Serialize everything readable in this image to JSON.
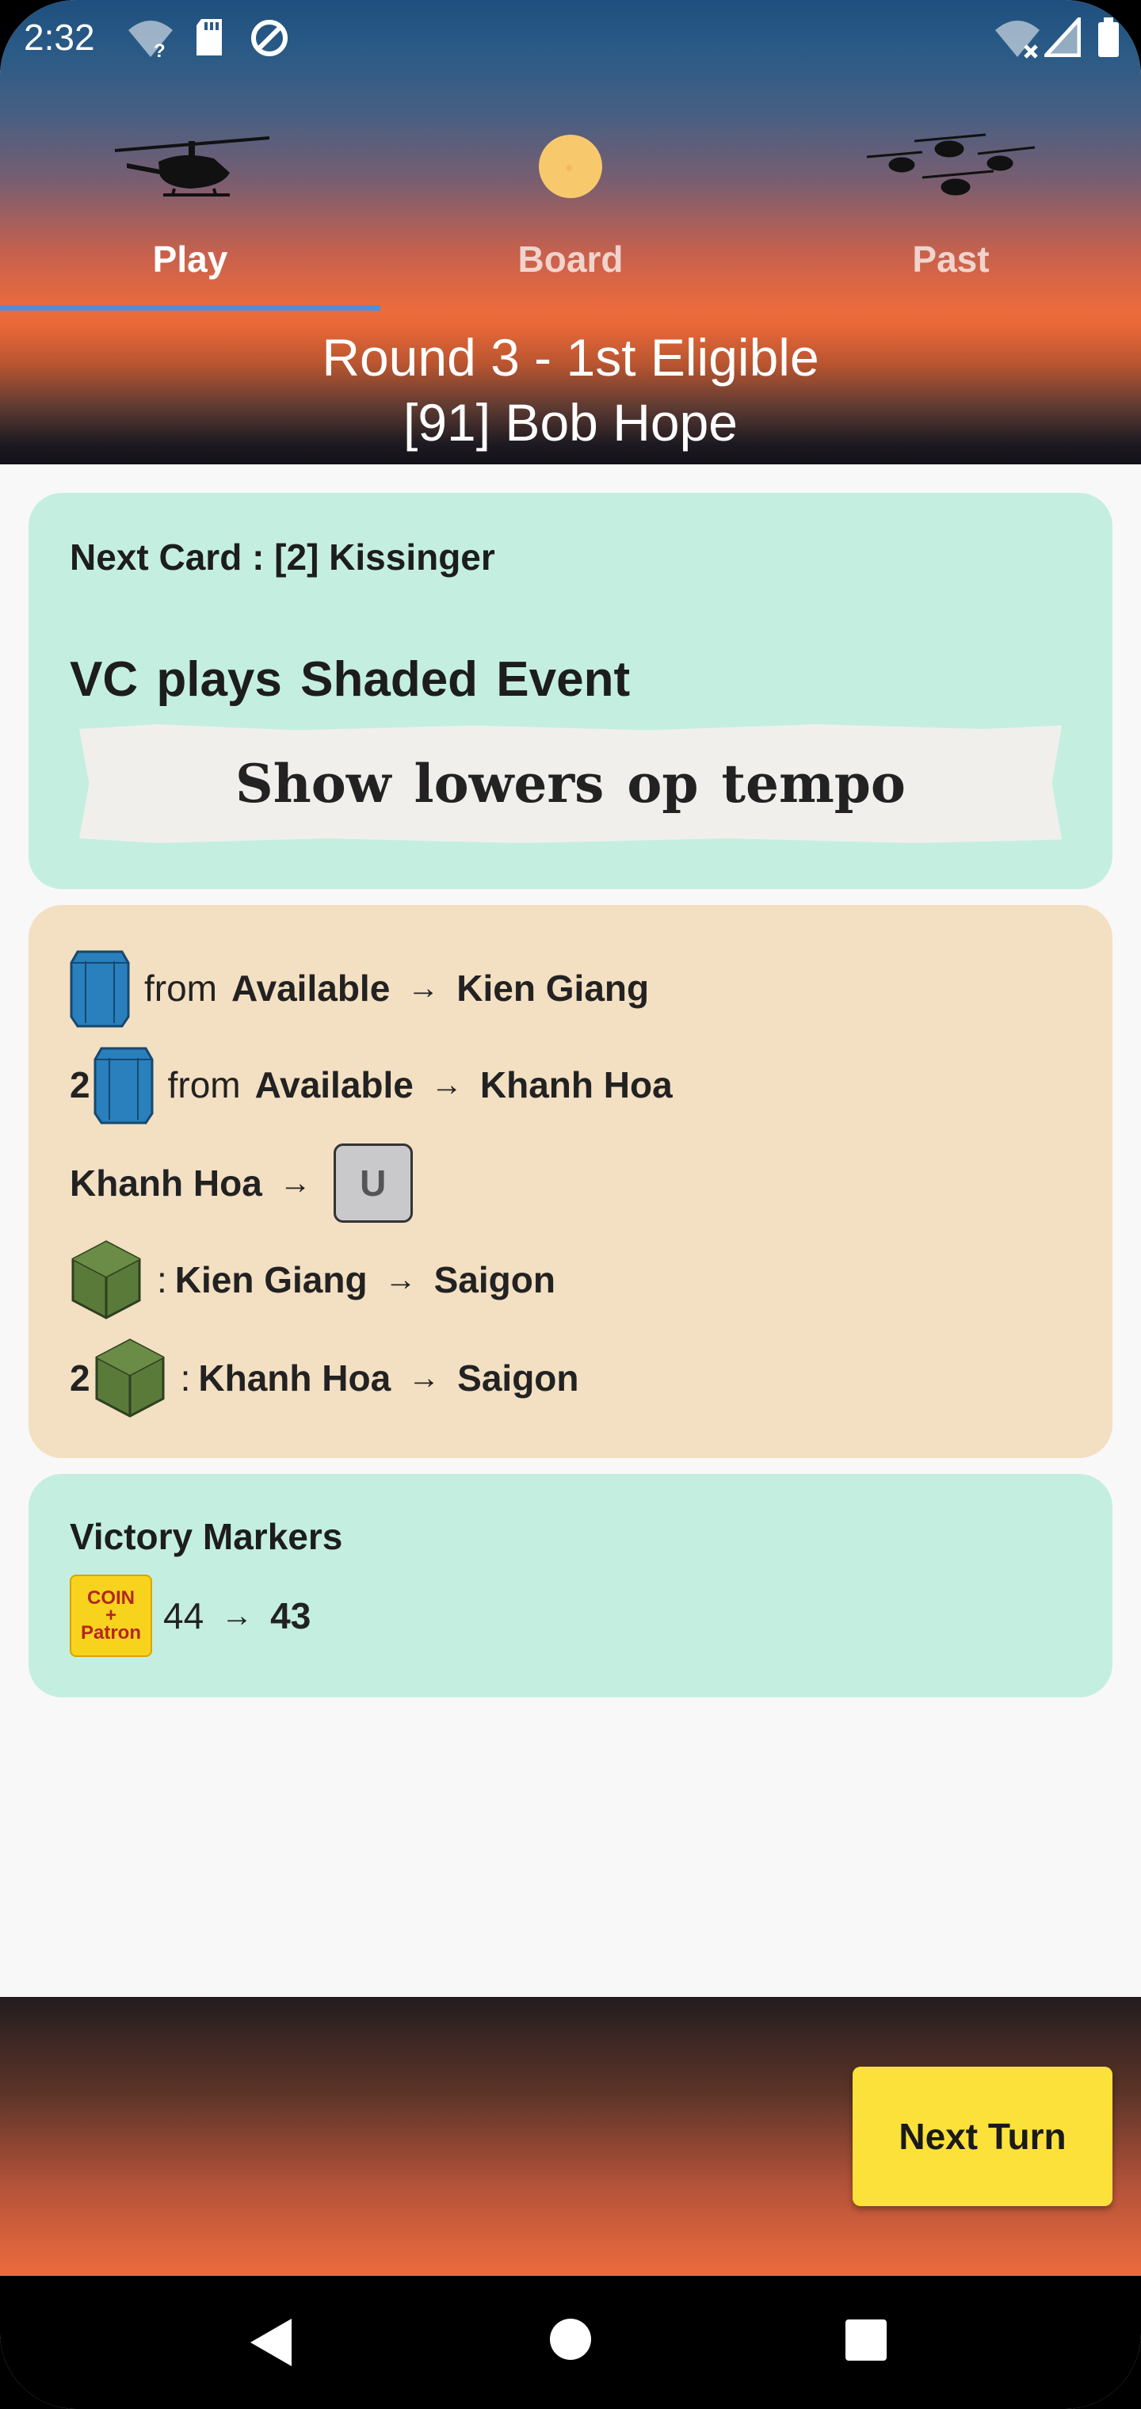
{
  "status_bar": {
    "time": "2:32",
    "icons": [
      "wifi-unknown-icon",
      "sd-card-icon",
      "sync-icon",
      "wifi-off-icon",
      "signal-icon",
      "battery-icon"
    ]
  },
  "tabs": [
    {
      "label": "Play",
      "icon": "helicopter-icon",
      "active": true
    },
    {
      "label": "Board",
      "icon": "sun-icon",
      "active": false
    },
    {
      "label": "Past",
      "icon": "helicopter-squadron-icon",
      "active": false
    }
  ],
  "round": {
    "line1": "Round 3 - 1st Eligible",
    "line2": "[91] Bob Hope"
  },
  "event_card": {
    "next_card": "Next Card : [2] Kissinger",
    "action": "VC plays Shaded Event",
    "event_text": "Show lowers op tempo"
  },
  "moves": [
    {
      "count": "",
      "piece": "us-base-blue-icon",
      "text1": "from",
      "source": "Available",
      "arrow": "→",
      "dest": "Kien Giang"
    },
    {
      "count": "2",
      "piece": "us-base-blue-icon",
      "text1": "from",
      "source": "Available",
      "arrow": "→",
      "dest": "Khanh Hoa"
    },
    {
      "location": "Khanh Hoa",
      "arrow": "→",
      "marker": "U"
    },
    {
      "count": "",
      "piece": "us-troop-cube-icon",
      "sep": ":",
      "source": "Kien Giang",
      "arrow": "→",
      "dest": "Saigon"
    },
    {
      "count": "2",
      "piece": "us-troop-cube-icon",
      "sep": ":",
      "source": "Khanh Hoa",
      "arrow": "→",
      "dest": "Saigon"
    }
  ],
  "victory": {
    "title": "Victory Markers",
    "badge_lines": [
      "COIN",
      "+",
      "Patron"
    ],
    "from": "44",
    "arrow": "→",
    "to": "43"
  },
  "next_button": "Next Turn",
  "colors": {
    "card_green": "#c4efe0",
    "card_tan": "#f3dfc2",
    "button_yellow": "#fce13b",
    "tab_indicator": "#4f8fd6",
    "piece_blue": "#2a7fbd",
    "piece_green": "#5a7a3a"
  },
  "nav": [
    "back-icon",
    "home-icon",
    "recents-icon"
  ]
}
